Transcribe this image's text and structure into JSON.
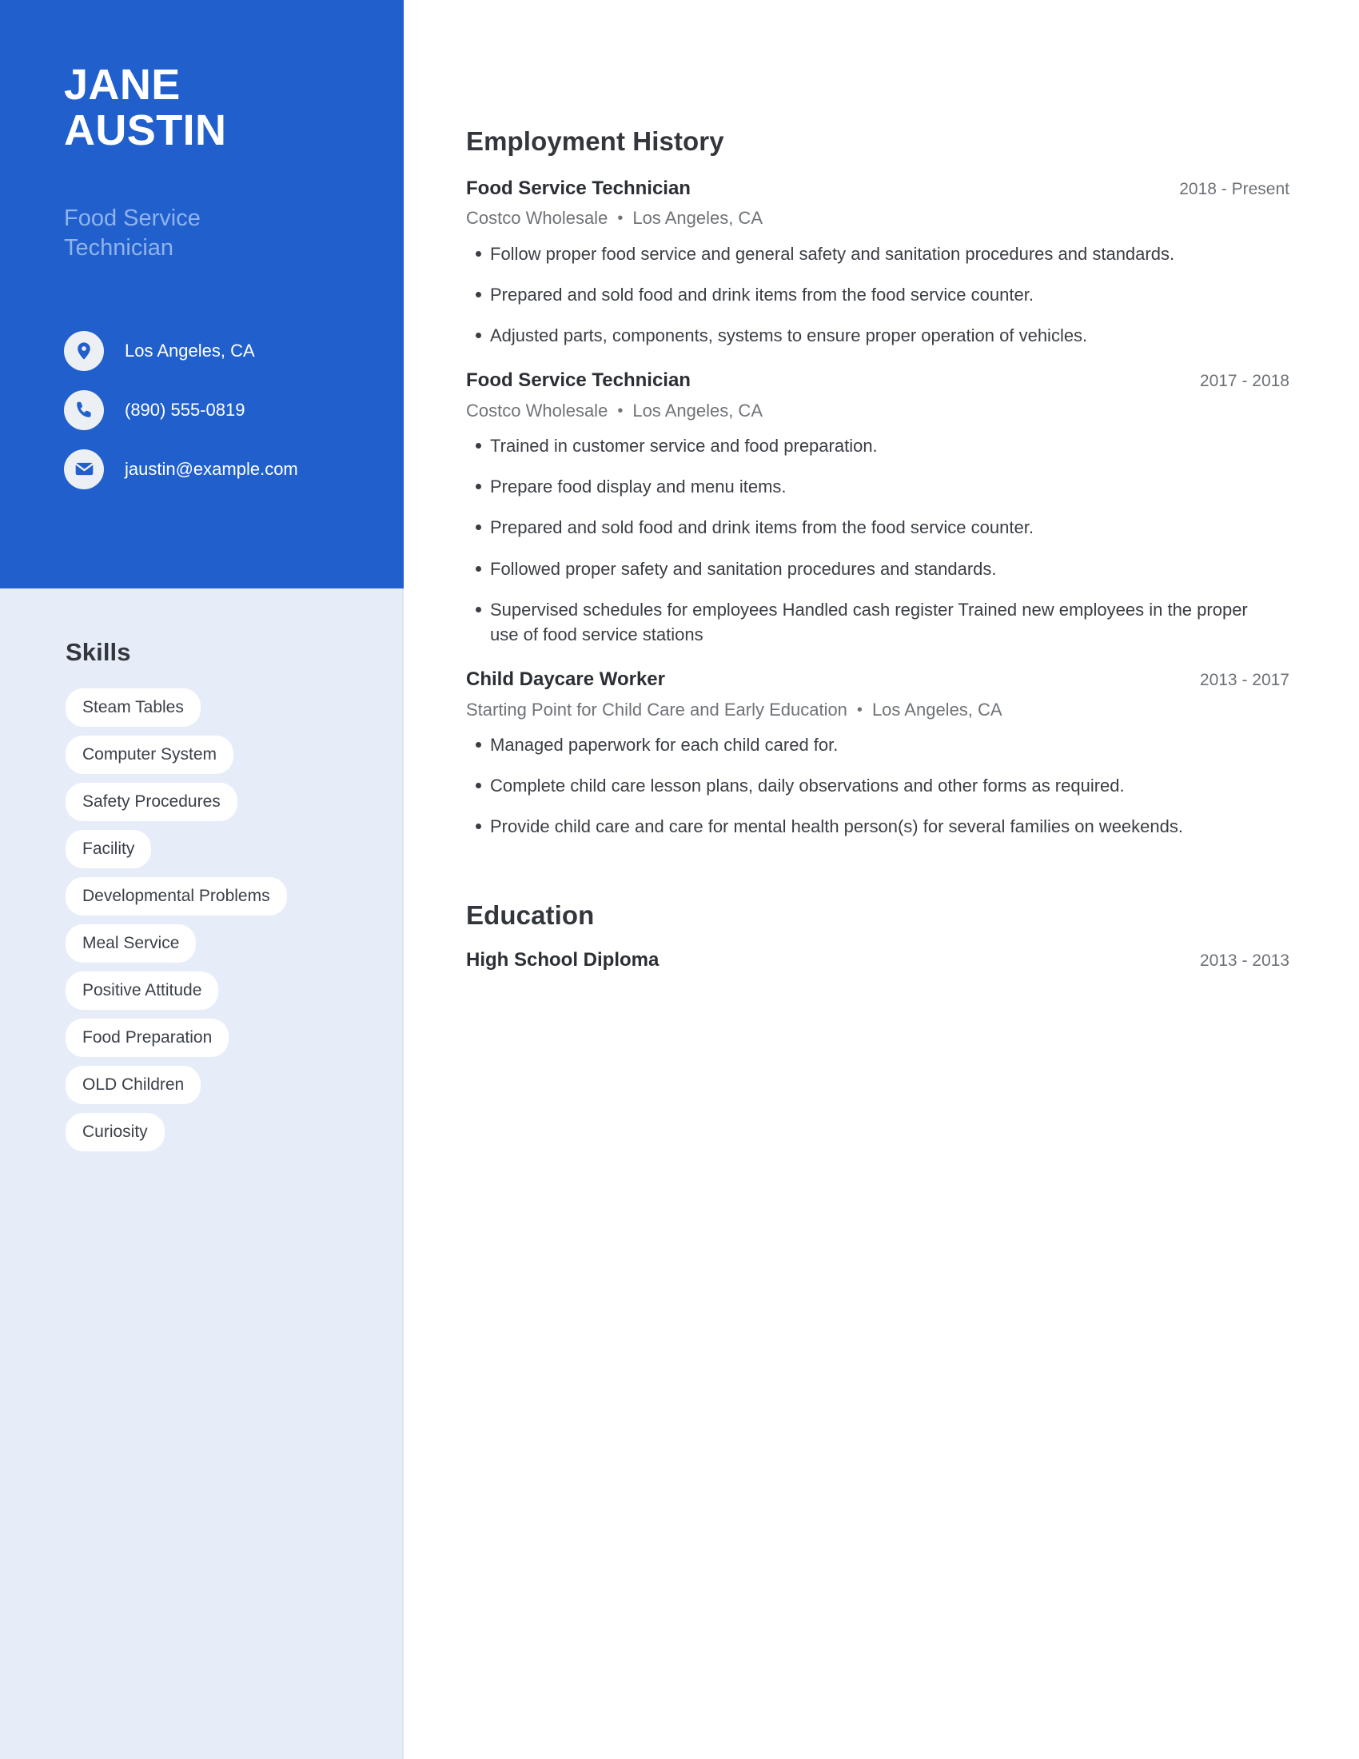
{
  "theme": {
    "accent_blue": "#2160cc",
    "sidebar_bg": "#e7edf8",
    "subtitle_blue": "#8fb3ec",
    "pill_bg": "#ffffff",
    "heading_color": "#33373d",
    "body_color": "#3a3e44",
    "muted_color": "#6f7378"
  },
  "sidebar": {
    "name": {
      "first": "JANE",
      "last": "AUSTIN"
    },
    "job_title": {
      "line1": "Food Service",
      "line2": "Technician"
    },
    "contacts": [
      {
        "icon": "location-pin-icon",
        "value": "Los Angeles, CA"
      },
      {
        "icon": "phone-icon",
        "value": "(890) 555-0819"
      },
      {
        "icon": "envelope-icon",
        "value": "jaustin@example.com"
      }
    ],
    "skills": {
      "heading": "Skills",
      "items": [
        "Steam Tables",
        "Computer System",
        "Safety Procedures",
        "Facility",
        "Developmental Problems",
        "Meal Service",
        "Positive Attitude",
        "Food Preparation",
        "OLD Children",
        "Curiosity"
      ]
    }
  },
  "main": {
    "employment": {
      "heading": "Employment History",
      "jobs": [
        {
          "role": "Food Service Technician",
          "dates": "2018 - Present",
          "company": "Costco Wholesale",
          "separator": "•",
          "location": "Los Angeles, CA",
          "bullets": [
            "Follow proper food service and general safety and sanitation procedures and standards.",
            "Prepared and sold food and drink items from the food service counter.",
            "Adjusted parts, components, systems to ensure proper operation of vehicles."
          ]
        },
        {
          "role": "Food Service Technician",
          "dates": "2017 - 2018",
          "company": "Costco Wholesale",
          "separator": "•",
          "location": "Los Angeles, CA",
          "bullets": [
            "Trained in customer service and food preparation.",
            "Prepare food display and menu items.",
            "Prepared and sold food and drink items from the food service counter.",
            "Followed proper safety and sanitation procedures and standards.",
            "Supervised schedules for employees Handled cash register Trained new employees in the proper use of food service stations"
          ]
        },
        {
          "role": "Child Daycare Worker",
          "dates": "2013 - 2017",
          "company": "Starting Point for Child Care and Early Education",
          "separator": "•",
          "location": "Los Angeles, CA",
          "bullets": [
            "Managed paperwork for each child cared for.",
            "Complete child care lesson plans, daily observations and other forms as required.",
            "Provide child care and care for mental health person(s) for several families on weekends."
          ]
        }
      ]
    },
    "education": {
      "heading": "Education",
      "entries": [
        {
          "degree": "High School Diploma",
          "dates": "2013 - 2013"
        }
      ]
    }
  }
}
